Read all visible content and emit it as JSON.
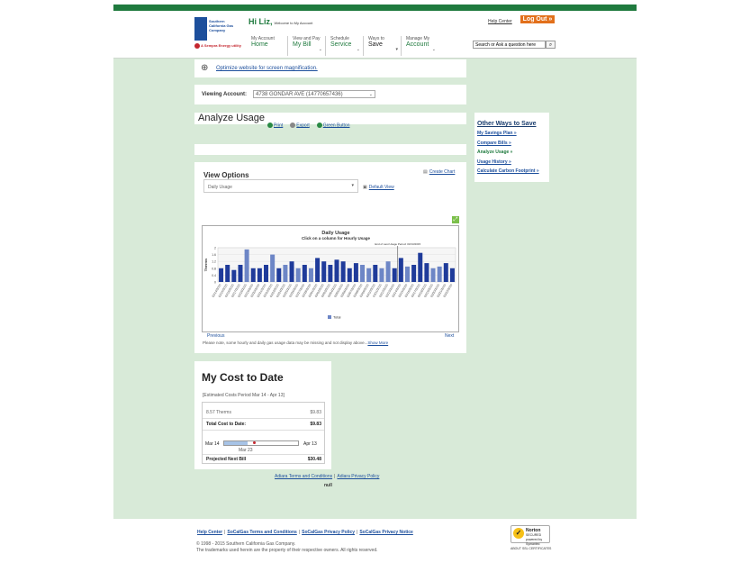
{
  "header": {
    "logo_text": "Southern California Gas Company",
    "logo_sub": "A Sempra Energy utility",
    "greeting": "Hi Liz,",
    "greeting_sub": "Welcome to My Account",
    "help_center": "Help Center",
    "logout": "Log Out »",
    "nav": [
      {
        "top": "My Account",
        "main": "Home"
      },
      {
        "top": "View and Pay",
        "main": "My Bill"
      },
      {
        "top": "Schedule",
        "main": "Service"
      },
      {
        "top": "Ways to",
        "main": "Save"
      },
      {
        "top": "Manage My",
        "main": "Account"
      }
    ],
    "search_placeholder": "Search or Ask a question here"
  },
  "magnification": {
    "link": "Optimize website for screen magnification."
  },
  "viewing_account": {
    "label": "Viewing Account:",
    "value": "4738 GONDAR AVE (14770657436)"
  },
  "analyze_usage": {
    "title": "Analyze Usage",
    "actions": [
      "Print",
      "Export",
      "Green Button"
    ]
  },
  "view_options": {
    "title": "View Options",
    "create_chart": "Create Chart",
    "select_value": "Daily Usage",
    "default_view": "Default View",
    "previous": "Previous",
    "next": "Next",
    "note": "Please note, some hourly and daily gas usage data may be missing and not display above.",
    "show_more": "Show More"
  },
  "chart_data": {
    "type": "bar",
    "title": "Daily Usage",
    "subtitle": "Click on a column for Hourly Usage",
    "annotation": "End of Last Usage Period: 03/13/2015",
    "ylabel": "Therms",
    "ylim": [
      0,
      2
    ],
    "yticks": [
      "2",
      "1.6",
      "1.2",
      "0.8",
      "0.4",
      "0"
    ],
    "legend": "Total",
    "categories": [
      "02/14/2015",
      "02/15/2015",
      "02/16/2015",
      "02/17/2015",
      "02/18/2015",
      "02/19/2015",
      "02/20/2015",
      "02/21/2015",
      "02/22/2015",
      "02/23/2015",
      "02/24/2015",
      "02/25/2015",
      "02/26/2015",
      "02/27/2015",
      "02/28/2015",
      "03/01/2015",
      "03/02/2015",
      "03/03/2015",
      "03/04/2015",
      "03/05/2015",
      "03/06/2015",
      "03/07/2015",
      "03/08/2015",
      "03/09/2015",
      "03/10/2015",
      "03/11/2015",
      "03/12/2015",
      "03/13/2015",
      "03/14/2015",
      "03/15/2015",
      "03/16/2015",
      "03/17/2015",
      "03/18/2015",
      "03/19/2015",
      "03/20/2015",
      "03/21/2015",
      "03/22/2015"
    ],
    "values": [
      0.8,
      1.0,
      0.7,
      1.0,
      1.9,
      0.8,
      0.8,
      1.0,
      1.6,
      0.8,
      1.0,
      1.2,
      0.8,
      1.0,
      0.8,
      1.4,
      1.2,
      1.0,
      1.3,
      1.2,
      0.8,
      1.1,
      1.0,
      0.8,
      1.0,
      0.8,
      1.2,
      0.8,
      1.4,
      0.9,
      1.0,
      1.7,
      1.1,
      0.8,
      0.9,
      1.1,
      0.8
    ],
    "highlighted": [
      4,
      8,
      10,
      12,
      14,
      22,
      23,
      25,
      26,
      29,
      33,
      34
    ],
    "colors": {
      "primary": "#1f3b9a",
      "highlight": "#6d86c6"
    },
    "end_marker_index": 27
  },
  "other_ways": {
    "title": "Other Ways to Save",
    "items": [
      "My Savings Plan »",
      "Compare Bills »",
      "Analyze Usage »",
      "Usage History »",
      "Calculate Carbon Footprint »"
    ],
    "active_index": 2
  },
  "cost_to_date": {
    "title": "My Cost to Date",
    "period": "[Estimated Costs Period Mar 14 - Apr 13]",
    "therms_label": "8.57 Therms",
    "therms_value": "$9.83",
    "total_label": "Total Cost to Date:",
    "total_value": "$9.83",
    "range_start": "Mar 14",
    "range_end": "Apr 13",
    "range_mid": "Mar 23",
    "progress": 0.32,
    "projected_label": "Projected Next Bill",
    "projected_value": "$30.48"
  },
  "inner_footer": {
    "terms": "Adiara Terms and Conditions",
    "privacy": "Adiara Privacy Policy",
    "null_text": "null"
  },
  "footer": {
    "links": [
      "Help Center",
      "SoCalGas Terms and Conditions",
      "SoCalGas Privacy Policy",
      "SoCalGas Privacy Notice"
    ],
    "copyright": "© 1998 - 2015 Southern California Gas Company.",
    "trademark": "The trademarks used herein are the property of their respective owners. All rights reserved.",
    "norton": "Norton",
    "norton_sub": "SECURED",
    "norton_by": "powered by Symantec",
    "norton_about": "ABOUT SSL CERTIFICATES"
  }
}
